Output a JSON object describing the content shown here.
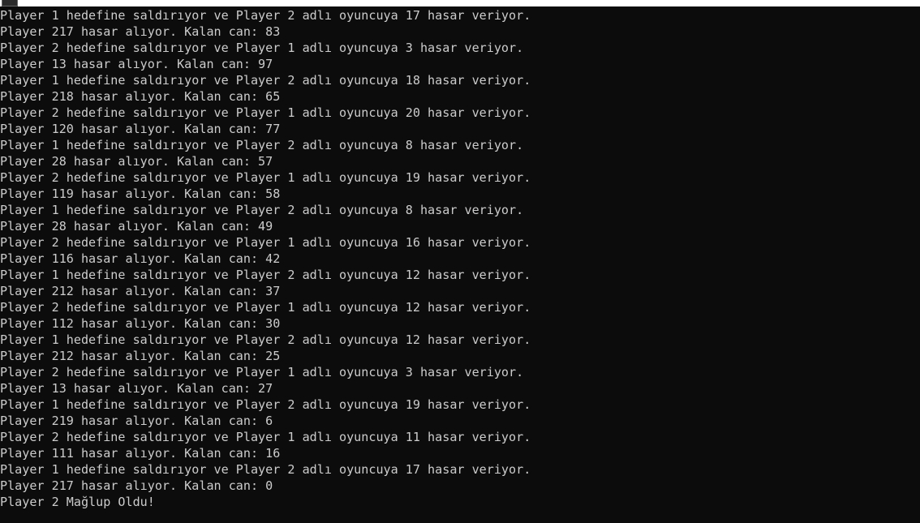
{
  "window": {
    "title": "",
    "icon": "console-icon"
  },
  "console": {
    "lines": [
      "Player 1 hedefine saldırıyor ve Player 2 adlı oyuncuya 17 hasar veriyor.",
      "Player 217 hasar alıyor. Kalan can: 83",
      "Player 2 hedefine saldırıyor ve Player 1 adlı oyuncuya 3 hasar veriyor.",
      "Player 13 hasar alıyor. Kalan can: 97",
      "Player 1 hedefine saldırıyor ve Player 2 adlı oyuncuya 18 hasar veriyor.",
      "Player 218 hasar alıyor. Kalan can: 65",
      "Player 2 hedefine saldırıyor ve Player 1 adlı oyuncuya 20 hasar veriyor.",
      "Player 120 hasar alıyor. Kalan can: 77",
      "Player 1 hedefine saldırıyor ve Player 2 adlı oyuncuya 8 hasar veriyor.",
      "Player 28 hasar alıyor. Kalan can: 57",
      "Player 2 hedefine saldırıyor ve Player 1 adlı oyuncuya 19 hasar veriyor.",
      "Player 119 hasar alıyor. Kalan can: 58",
      "Player 1 hedefine saldırıyor ve Player 2 adlı oyuncuya 8 hasar veriyor.",
      "Player 28 hasar alıyor. Kalan can: 49",
      "Player 2 hedefine saldırıyor ve Player 1 adlı oyuncuya 16 hasar veriyor.",
      "Player 116 hasar alıyor. Kalan can: 42",
      "Player 1 hedefine saldırıyor ve Player 2 adlı oyuncuya 12 hasar veriyor.",
      "Player 212 hasar alıyor. Kalan can: 37",
      "Player 2 hedefine saldırıyor ve Player 1 adlı oyuncuya 12 hasar veriyor.",
      "Player 112 hasar alıyor. Kalan can: 30",
      "Player 1 hedefine saldırıyor ve Player 2 adlı oyuncuya 12 hasar veriyor.",
      "Player 212 hasar alıyor. Kalan can: 25",
      "Player 2 hedefine saldırıyor ve Player 1 adlı oyuncuya 3 hasar veriyor.",
      "Player 13 hasar alıyor. Kalan can: 27",
      "Player 1 hedefine saldırıyor ve Player 2 adlı oyuncuya 19 hasar veriyor.",
      "Player 219 hasar alıyor. Kalan can: 6",
      "Player 2 hedefine saldırıyor ve Player 1 adlı oyuncuya 11 hasar veriyor.",
      "Player 111 hasar alıyor. Kalan can: 16",
      "Player 1 hedefine saldırıyor ve Player 2 adlı oyuncuya 17 hasar veriyor.",
      "Player 217 hasar alıyor. Kalan can: 0",
      "Player 2 Mağlup Oldu!"
    ]
  },
  "colors": {
    "background": "#0c0c0c",
    "text": "#cccccc",
    "titlebar": "#ffffff"
  }
}
